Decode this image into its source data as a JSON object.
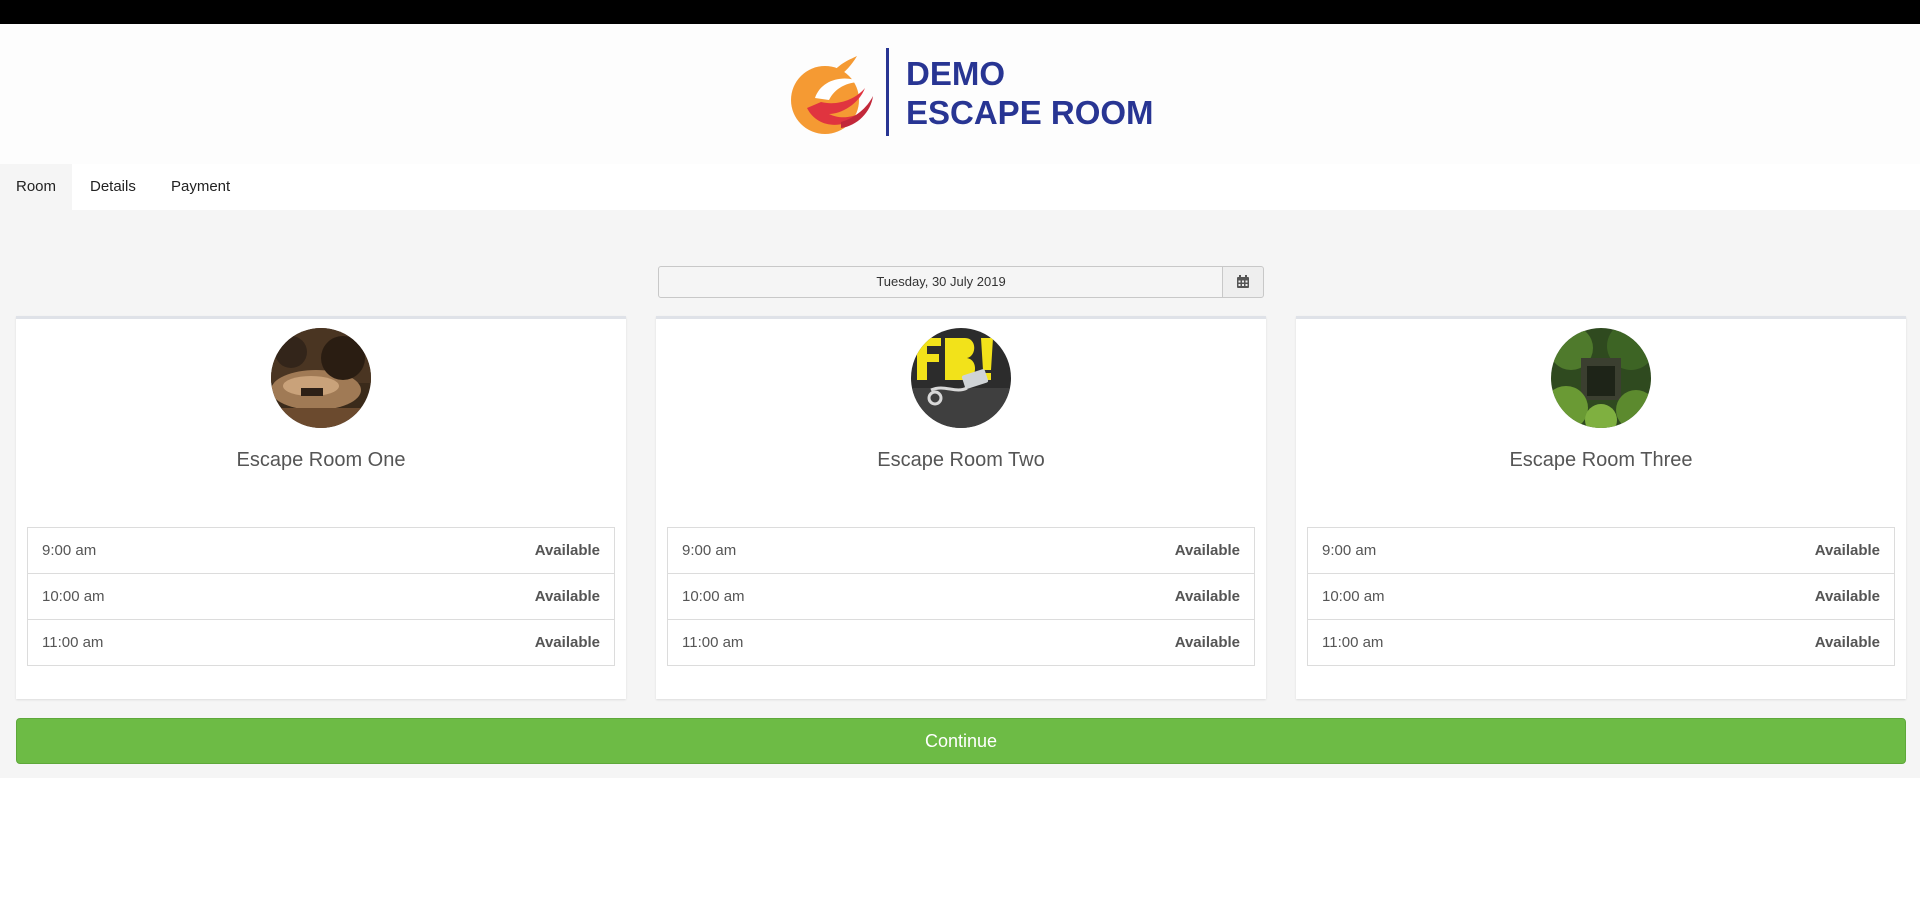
{
  "brand": {
    "line1": "DEMO",
    "line2": "ESCAPE ROOM",
    "color": "#283593"
  },
  "tabs": [
    {
      "label": "Room",
      "active": true
    },
    {
      "label": "Details",
      "active": false
    },
    {
      "label": "Payment",
      "active": false
    }
  ],
  "date_picker": {
    "value": "Tuesday, 30 July 2019",
    "icon": "calendar-icon"
  },
  "rooms": [
    {
      "name": "Escape Room One",
      "slots": [
        {
          "time": "9:00 am",
          "status": "Available"
        },
        {
          "time": "10:00 am",
          "status": "Available"
        },
        {
          "time": "11:00 am",
          "status": "Available"
        }
      ]
    },
    {
      "name": "Escape Room Two",
      "slots": [
        {
          "time": "9:00 am",
          "status": "Available"
        },
        {
          "time": "10:00 am",
          "status": "Available"
        },
        {
          "time": "11:00 am",
          "status": "Available"
        }
      ]
    },
    {
      "name": "Escape Room Three",
      "slots": [
        {
          "time": "9:00 am",
          "status": "Available"
        },
        {
          "time": "10:00 am",
          "status": "Available"
        },
        {
          "time": "11:00 am",
          "status": "Available"
        }
      ]
    }
  ],
  "continue_label": "Continue",
  "colors": {
    "accent_green": "#6dbb45",
    "page_bg": "#f5f5f5"
  }
}
